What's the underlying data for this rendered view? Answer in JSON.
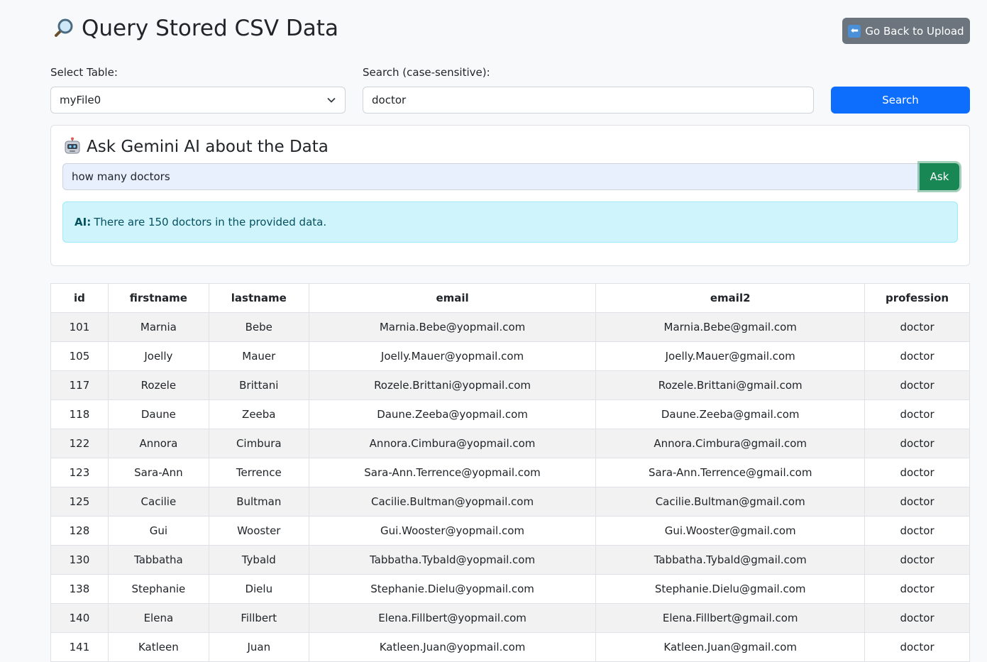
{
  "header": {
    "title": "Query Stored CSV Data",
    "title_icon": "magnifier-icon",
    "back_button_label": "Go Back to Upload",
    "back_icon": "left-arrow-icon"
  },
  "filters": {
    "select_label": "Select Table:",
    "selected_table": "myFile0",
    "search_label": "Search (case-sensitive):",
    "search_value": "doctor",
    "search_button_label": "Search"
  },
  "ai": {
    "title": "Ask Gemini AI about the Data",
    "title_icon": "robot-icon",
    "question_value": "how many doctors",
    "ask_button_label": "Ask",
    "answer_prefix": "AI:",
    "answer_text": "There are 150 doctors in the provided data."
  },
  "table": {
    "columns": [
      "id",
      "firstname",
      "lastname",
      "email",
      "email2",
      "profession"
    ],
    "rows": [
      [
        "101",
        "Marnia",
        "Bebe",
        "Marnia.Bebe@yopmail.com",
        "Marnia.Bebe@gmail.com",
        "doctor"
      ],
      [
        "105",
        "Joelly",
        "Mauer",
        "Joelly.Mauer@yopmail.com",
        "Joelly.Mauer@gmail.com",
        "doctor"
      ],
      [
        "117",
        "Rozele",
        "Brittani",
        "Rozele.Brittani@yopmail.com",
        "Rozele.Brittani@gmail.com",
        "doctor"
      ],
      [
        "118",
        "Daune",
        "Zeeba",
        "Daune.Zeeba@yopmail.com",
        "Daune.Zeeba@gmail.com",
        "doctor"
      ],
      [
        "122",
        "Annora",
        "Cimbura",
        "Annora.Cimbura@yopmail.com",
        "Annora.Cimbura@gmail.com",
        "doctor"
      ],
      [
        "123",
        "Sara-Ann",
        "Terrence",
        "Sara-Ann.Terrence@yopmail.com",
        "Sara-Ann.Terrence@gmail.com",
        "doctor"
      ],
      [
        "125",
        "Cacilie",
        "Bultman",
        "Cacilie.Bultman@yopmail.com",
        "Cacilie.Bultman@gmail.com",
        "doctor"
      ],
      [
        "128",
        "Gui",
        "Wooster",
        "Gui.Wooster@yopmail.com",
        "Gui.Wooster@gmail.com",
        "doctor"
      ],
      [
        "130",
        "Tabbatha",
        "Tybald",
        "Tabbatha.Tybald@yopmail.com",
        "Tabbatha.Tybald@gmail.com",
        "doctor"
      ],
      [
        "138",
        "Stephanie",
        "Dielu",
        "Stephanie.Dielu@yopmail.com",
        "Stephanie.Dielu@gmail.com",
        "doctor"
      ],
      [
        "140",
        "Elena",
        "Fillbert",
        "Elena.Fillbert@yopmail.com",
        "Elena.Fillbert@gmail.com",
        "doctor"
      ],
      [
        "141",
        "Katleen",
        "Juan",
        "Katleen.Juan@yopmail.com",
        "Katleen.Juan@gmail.com",
        "doctor"
      ]
    ]
  },
  "colors": {
    "primary": "#0d6efd",
    "secondary": "#6c757d",
    "success": "#198754",
    "info_bg": "#cff4fc",
    "info_text": "#055160"
  }
}
